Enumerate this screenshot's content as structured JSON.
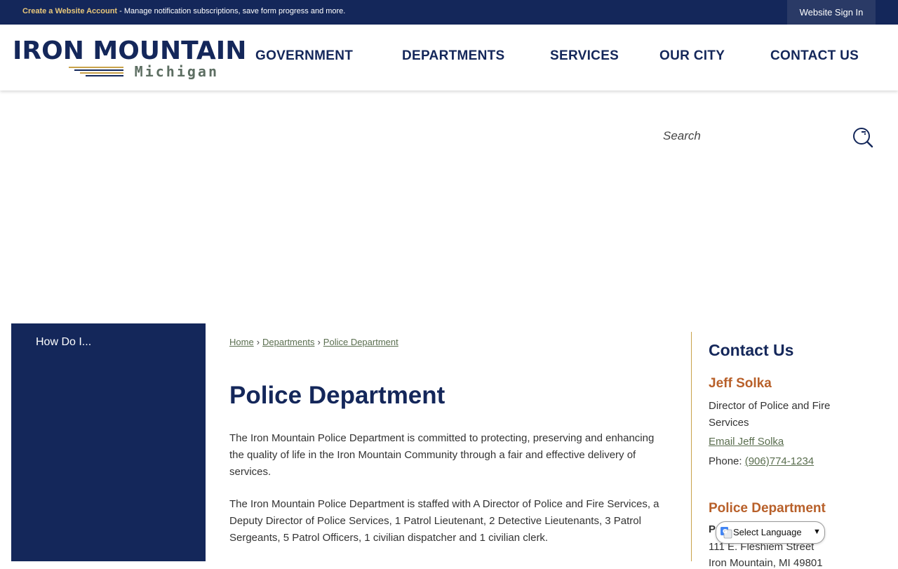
{
  "topbar": {
    "account_link": "Create a Website Account",
    "account_desc": " - Manage notification subscriptions, save form progress and more.",
    "sign_in": "Website Sign In"
  },
  "logo": {
    "main": "IRON MOUNTAIN",
    "sub": "Michigan"
  },
  "nav": {
    "items": [
      "GOVERNMENT",
      "DEPARTMENTS",
      "SERVICES",
      "OUR CITY",
      "CONTACT US"
    ]
  },
  "search": {
    "placeholder": "Search",
    "icon": "search-icon"
  },
  "sidebar": {
    "how_do_i": "How Do I..."
  },
  "breadcrumb": {
    "items": [
      "Home",
      "Departments",
      "Police Department"
    ],
    "separator": "›"
  },
  "page": {
    "title": "Police Department",
    "p1": "The Iron Mountain Police Department is committed to protecting, preserving and enhancing the quality of life in the Iron Mountain Community through a fair and effective delivery of services.",
    "p2": "The Iron Mountain Police Department is staffed with A Director of Police and Fire Services, a Deputy Director of Police Services, 1 Patrol Lieutenant, 2 Detective Lieutenants, 3 Patrol Sergeants, 5 Patrol Officers, 1 civilian dispatcher and 1 civilian clerk."
  },
  "contact": {
    "heading": "Contact Us",
    "name": "Jeff Solka",
    "role": "Director of Police and Fire Services",
    "email": "Email Jeff Solka",
    "phone_label": "Phone: ",
    "phone": "(906)774-1234",
    "dept": "Police Department",
    "addr_line1": "P",
    "addr_line2": "111 E. Fleshiem Street",
    "addr_line3": "Iron Mountain, MI 49801"
  },
  "translate": {
    "label": "Select Language"
  },
  "colors": {
    "navy": "#14275a",
    "accent_orange": "#b8602a",
    "link_green": "#5a6e4f",
    "gold": "#c9a24a"
  }
}
